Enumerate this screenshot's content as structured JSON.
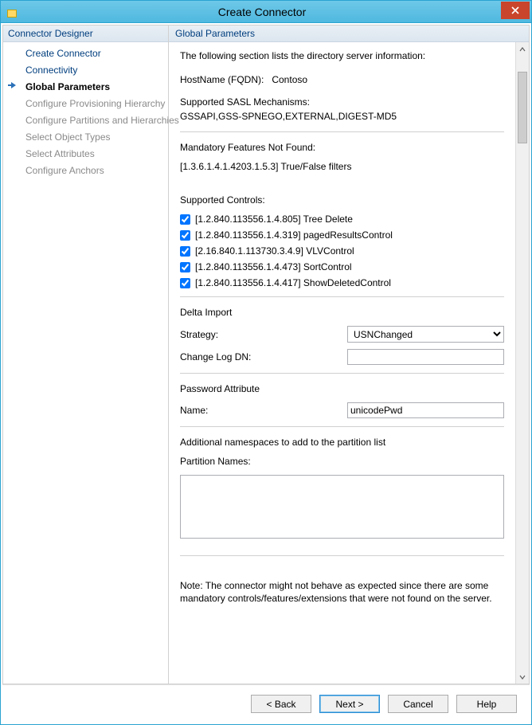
{
  "window": {
    "title": "Create Connector"
  },
  "sidebar": {
    "header": "Connector Designer",
    "items": [
      {
        "label": "Create Connector",
        "type": "normal"
      },
      {
        "label": "Connectivity",
        "type": "normal"
      },
      {
        "label": "Global Parameters",
        "type": "current"
      },
      {
        "label": "Configure Provisioning Hierarchy",
        "type": "sub"
      },
      {
        "label": "Configure Partitions and Hierarchies",
        "type": "sub"
      },
      {
        "label": "Select Object Types",
        "type": "sub"
      },
      {
        "label": "Select Attributes",
        "type": "sub"
      },
      {
        "label": "Configure Anchors",
        "type": "sub"
      }
    ]
  },
  "main": {
    "header": "Global Parameters",
    "intro": "The following section lists the directory server information:",
    "hostname_label": "HostName (FQDN):",
    "hostname_value": "Contoso",
    "sasl_label": "Supported SASL Mechanisms:",
    "sasl_value": "GSSAPI,GSS-SPNEGO,EXTERNAL,DIGEST-MD5",
    "mandatory_label": "Mandatory Features Not Found:",
    "mandatory_value": "[1.3.6.1.4.1.4203.1.5.3] True/False filters",
    "supported_controls_label": "Supported Controls:",
    "controls": [
      {
        "checked": true,
        "label": "[1.2.840.113556.1.4.805] Tree Delete"
      },
      {
        "checked": true,
        "label": "[1.2.840.113556.1.4.319] pagedResultsControl"
      },
      {
        "checked": true,
        "label": "[2.16.840.1.113730.3.4.9] VLVControl"
      },
      {
        "checked": true,
        "label": "[1.2.840.113556.1.4.473] SortControl"
      },
      {
        "checked": true,
        "label": "[1.2.840.113556.1.4.417] ShowDeletedControl"
      }
    ],
    "delta_import_label": "Delta Import",
    "strategy_label": "Strategy:",
    "strategy_value": "USNChanged",
    "changelog_label": "Change Log DN:",
    "changelog_value": "",
    "password_attr_label": "Password Attribute",
    "pw_name_label": "Name:",
    "pw_name_value": "unicodePwd",
    "additional_ns_label": "Additional namespaces to add to the partition list",
    "partition_names_label": "Partition Names:",
    "partition_names_value": "",
    "note": "Note: The connector might not behave as expected since there are some mandatory controls/features/extensions that were not found on the server."
  },
  "footer": {
    "back": "<  Back",
    "next": "Next  >",
    "cancel": "Cancel",
    "help": "Help"
  }
}
